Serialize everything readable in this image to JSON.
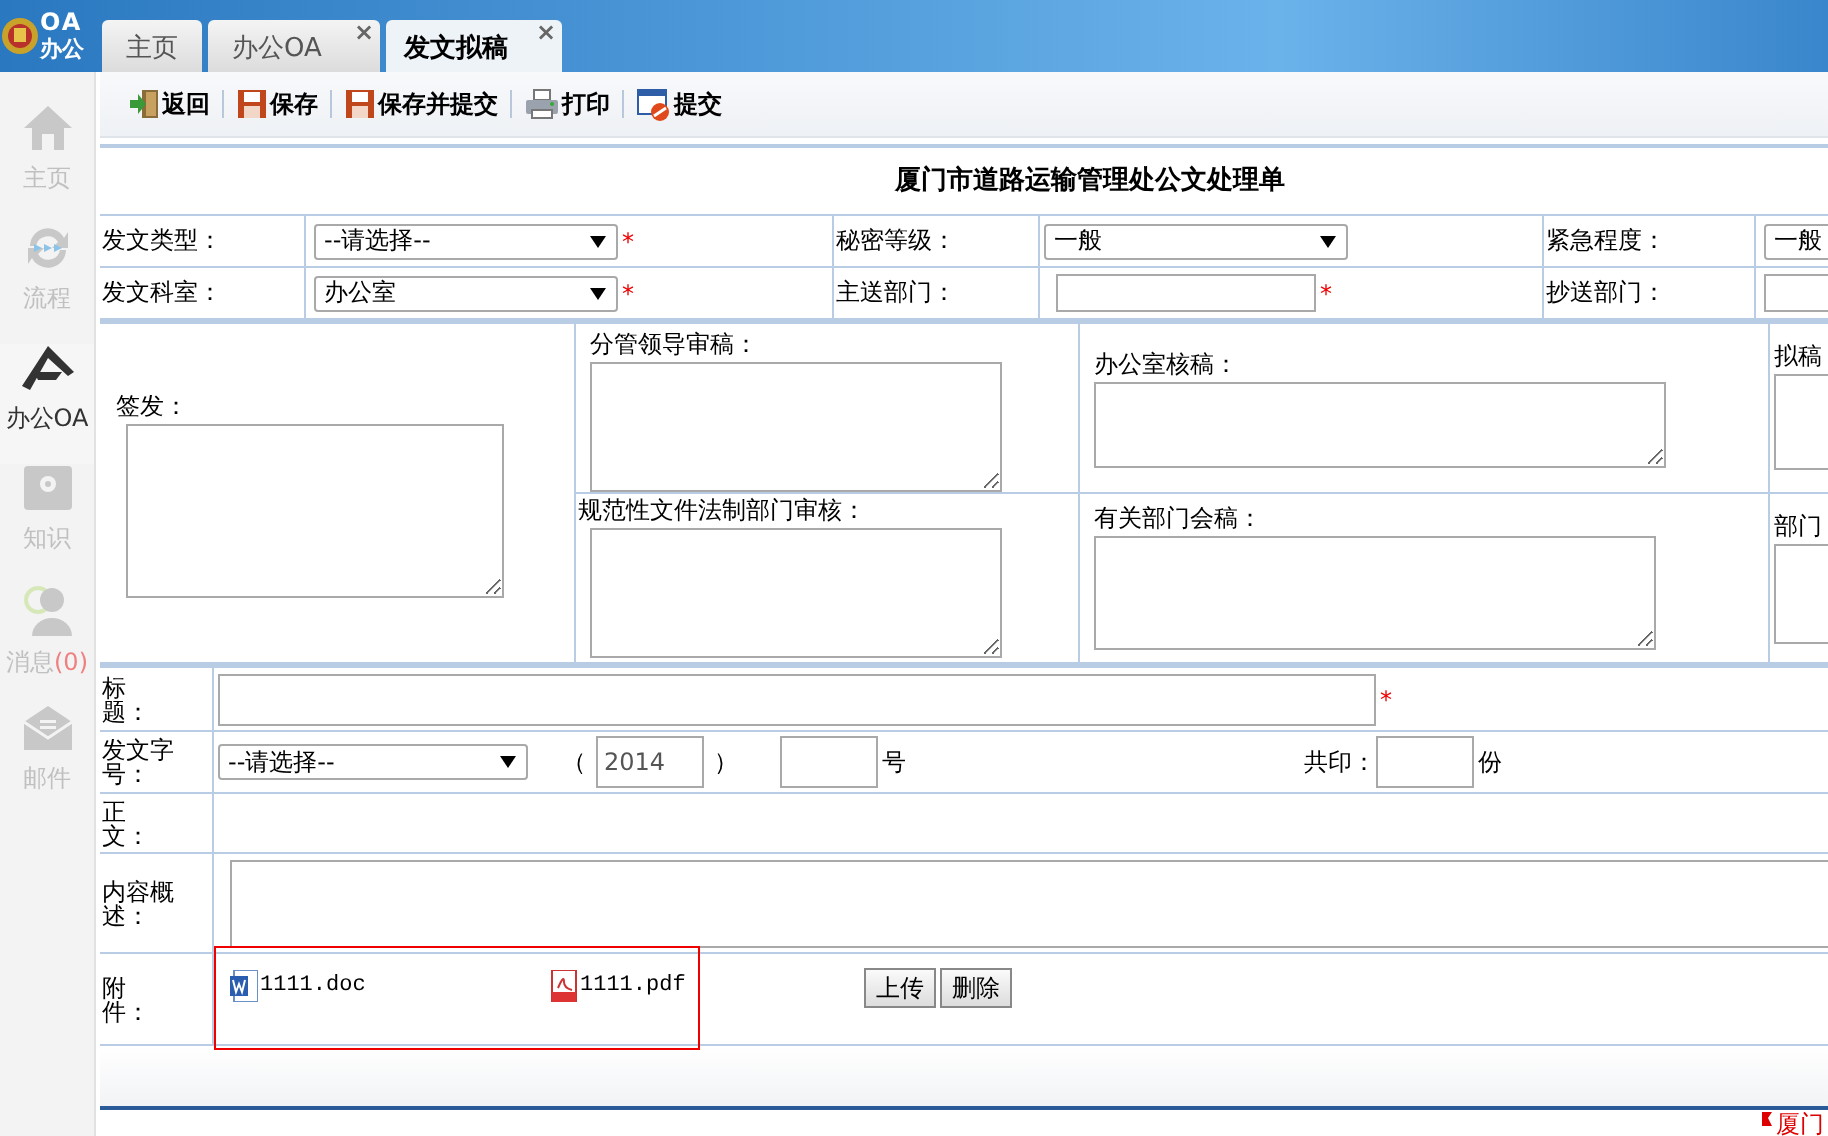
{
  "header": {
    "logo": {
      "line1": "OA",
      "line2": "办公"
    },
    "tabs": [
      {
        "label": "主页",
        "selected": false
      },
      {
        "label": "办公OA",
        "selected": false,
        "close": "×"
      },
      {
        "label": "发文拟稿",
        "selected": true,
        "close": "×"
      }
    ]
  },
  "sidebar": {
    "items": [
      {
        "label": "主页",
        "selected": false
      },
      {
        "label": "流程",
        "selected": false
      },
      {
        "label": "办公OA",
        "selected": true
      },
      {
        "label": "知识",
        "selected": false
      },
      {
        "label": "消息",
        "badge": "(0)",
        "selected": false
      },
      {
        "label": "邮件",
        "selected": false
      }
    ]
  },
  "toolbar": [
    {
      "label": "返回"
    },
    {
      "label": "保存"
    },
    {
      "label": "保存并提交"
    },
    {
      "label": "打印"
    },
    {
      "label": "提交"
    }
  ],
  "form": {
    "title": "厦门市道路运输管理处公文处理单",
    "header_rows": [
      [
        {
          "label": "发文类型：",
          "control": {
            "kind": "select",
            "value": "--请选择--"
          },
          "required_mark": "*"
        },
        {
          "label": "秘密等级：",
          "control": {
            "kind": "select",
            "value": "一般"
          }
        },
        {
          "label": "紧急程度：",
          "control": {
            "kind": "select",
            "value": "一般"
          }
        }
      ],
      [
        {
          "label": "发文科室：",
          "control": {
            "kind": "select",
            "value": "办公室"
          },
          "required_mark": "*"
        },
        {
          "label": "主送部门：",
          "control": {
            "kind": "input"
          },
          "required_mark": "*"
        },
        {
          "label": "抄送部门：",
          "control": {
            "kind": "input"
          }
        }
      ]
    ],
    "sign": {
      "label": "签发："
    },
    "reviews": [
      {
        "label": "分管领导审稿："
      },
      {
        "label": "办公室核稿："
      },
      {
        "label": "拟稿"
      },
      {
        "label": "规范性文件法制部门审核："
      },
      {
        "label": "有关部门会稿："
      },
      {
        "label": "部门"
      }
    ],
    "subject": {
      "label": "标题：",
      "required_mark": "*"
    },
    "doc_number": {
      "label": "发文字号：",
      "select": "--请选择--",
      "open": "（",
      "year": "2014",
      "close": "）",
      "suffix": "号",
      "copies_label": "共印：",
      "copies_suffix": "份"
    },
    "body": {
      "label": "正文："
    },
    "summary": {
      "label": "内容概述："
    },
    "attachments": {
      "label": "附件：",
      "files": [
        {
          "name": "1111.doc",
          "kind": "word"
        },
        {
          "name": "1111.pdf",
          "kind": "pdf"
        }
      ],
      "buttons": [
        "上传",
        "删除"
      ]
    }
  },
  "status_bar": {
    "text": "厦门"
  }
}
